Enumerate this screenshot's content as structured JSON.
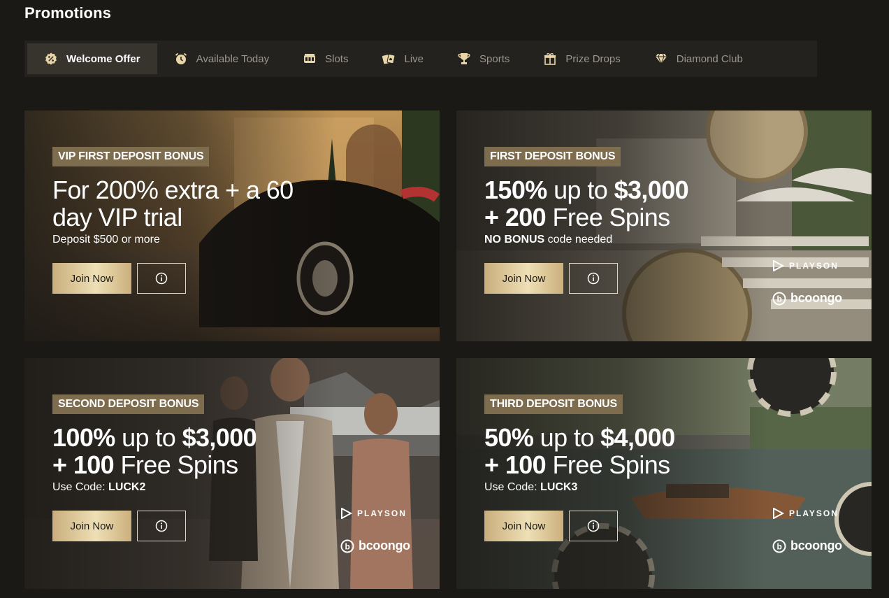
{
  "page": {
    "title": "Promotions"
  },
  "tabs": [
    {
      "label": "Welcome Offer",
      "icon": "percent-badge-icon",
      "active": true
    },
    {
      "label": "Available Today",
      "icon": "alarm-clock-icon",
      "active": false
    },
    {
      "label": "Slots",
      "icon": "slot-machine-icon",
      "active": false
    },
    {
      "label": "Live",
      "icon": "playing-cards-icon",
      "active": false
    },
    {
      "label": "Sports",
      "icon": "trophy-icon",
      "active": false
    },
    {
      "label": "Prize Drops",
      "icon": "gift-icon",
      "active": false
    },
    {
      "label": "Diamond Club",
      "icon": "diamond-icon",
      "active": false
    }
  ],
  "promos": [
    {
      "badge": "VIP FIRST DEPOSIT BONUS",
      "headline_line1": "For 200% extra + a 60",
      "headline_line2": "day VIP trial",
      "sub_bold": "",
      "sub_text": "Deposit $500 or more",
      "join_label": "Join Now",
      "providers": []
    },
    {
      "badge": "FIRST DEPOSIT BONUS",
      "headline_line1_bold_a": "150%",
      "headline_line1_mid": " up to ",
      "headline_line1_bold_b": "$3,000",
      "headline_line2_bold": "+ 200",
      "headline_line2_text": " Free Spins",
      "sub_bold": "NO BONUS",
      "sub_text": " code needed",
      "join_label": "Join Now",
      "providers": [
        "PLAYSON",
        "bcoongo"
      ]
    },
    {
      "badge": "SECOND DEPOSIT BONUS",
      "headline_line1_bold_a": "100%",
      "headline_line1_mid": " up to ",
      "headline_line1_bold_b": "$3,000",
      "headline_line2_bold": "+ 100",
      "headline_line2_text": " Free Spins",
      "sub_text": "Use Code: ",
      "sub_bold": "LUCK2",
      "join_label": "Join Now",
      "providers": [
        "PLAYSON",
        "bcoongo"
      ]
    },
    {
      "badge": "THIRD DEPOSIT BONUS",
      "headline_line1_bold_a": "50%",
      "headline_line1_mid": " up to ",
      "headline_line1_bold_b": "$4,000",
      "headline_line2_bold": "+ 100",
      "headline_line2_text": " Free Spins",
      "sub_text": "Use Code: ",
      "sub_bold": "LUCK3",
      "join_label": "Join Now",
      "providers": [
        "PLAYSON",
        "bcoongo"
      ]
    }
  ],
  "colors": {
    "background": "#1b1915",
    "tabbar": "#24221e",
    "tab_active": "#37342e",
    "badge": "#7e6c4f",
    "gold_button": "#e8d6a8"
  }
}
